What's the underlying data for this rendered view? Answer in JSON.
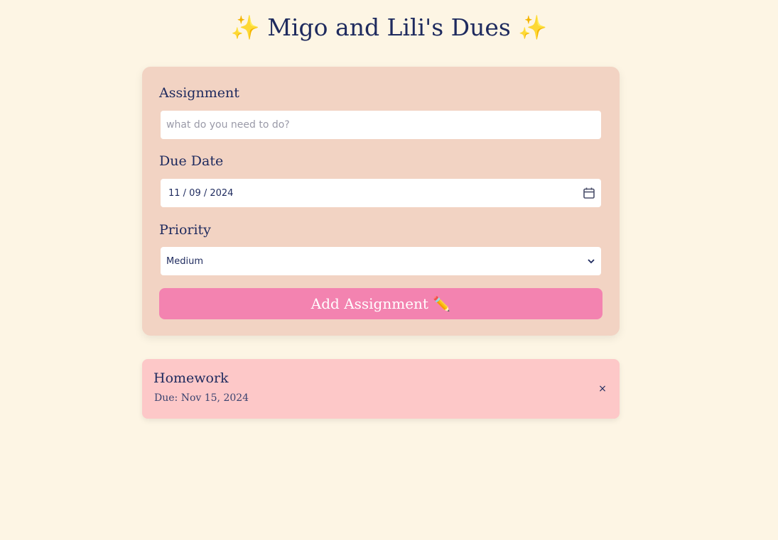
{
  "header": {
    "sparkle_left": "✨",
    "title": "Migo and Lili's Dues",
    "sparkle_right": "✨"
  },
  "form": {
    "assignment": {
      "label": "Assignment",
      "placeholder": "what do you need to do?",
      "value": ""
    },
    "due_date": {
      "label": "Due Date",
      "value": "11 / 09 / 2024",
      "icon": "calendar-icon"
    },
    "priority": {
      "label": "Priority",
      "selected": "Medium",
      "icon": "chevron-down-icon"
    },
    "submit_label": "Add Assignment ✏️"
  },
  "assignments": [
    {
      "name": "Homework",
      "due": "Due: Nov 15, 2024",
      "remove_label": "×"
    }
  ],
  "colors": {
    "background": "#fdf5e4",
    "form_card": "#f2d3c3",
    "button": "#f383b0",
    "item_card": "#fdc8c8",
    "text": "#1e2a5e",
    "sparkle": "#f6a623"
  }
}
